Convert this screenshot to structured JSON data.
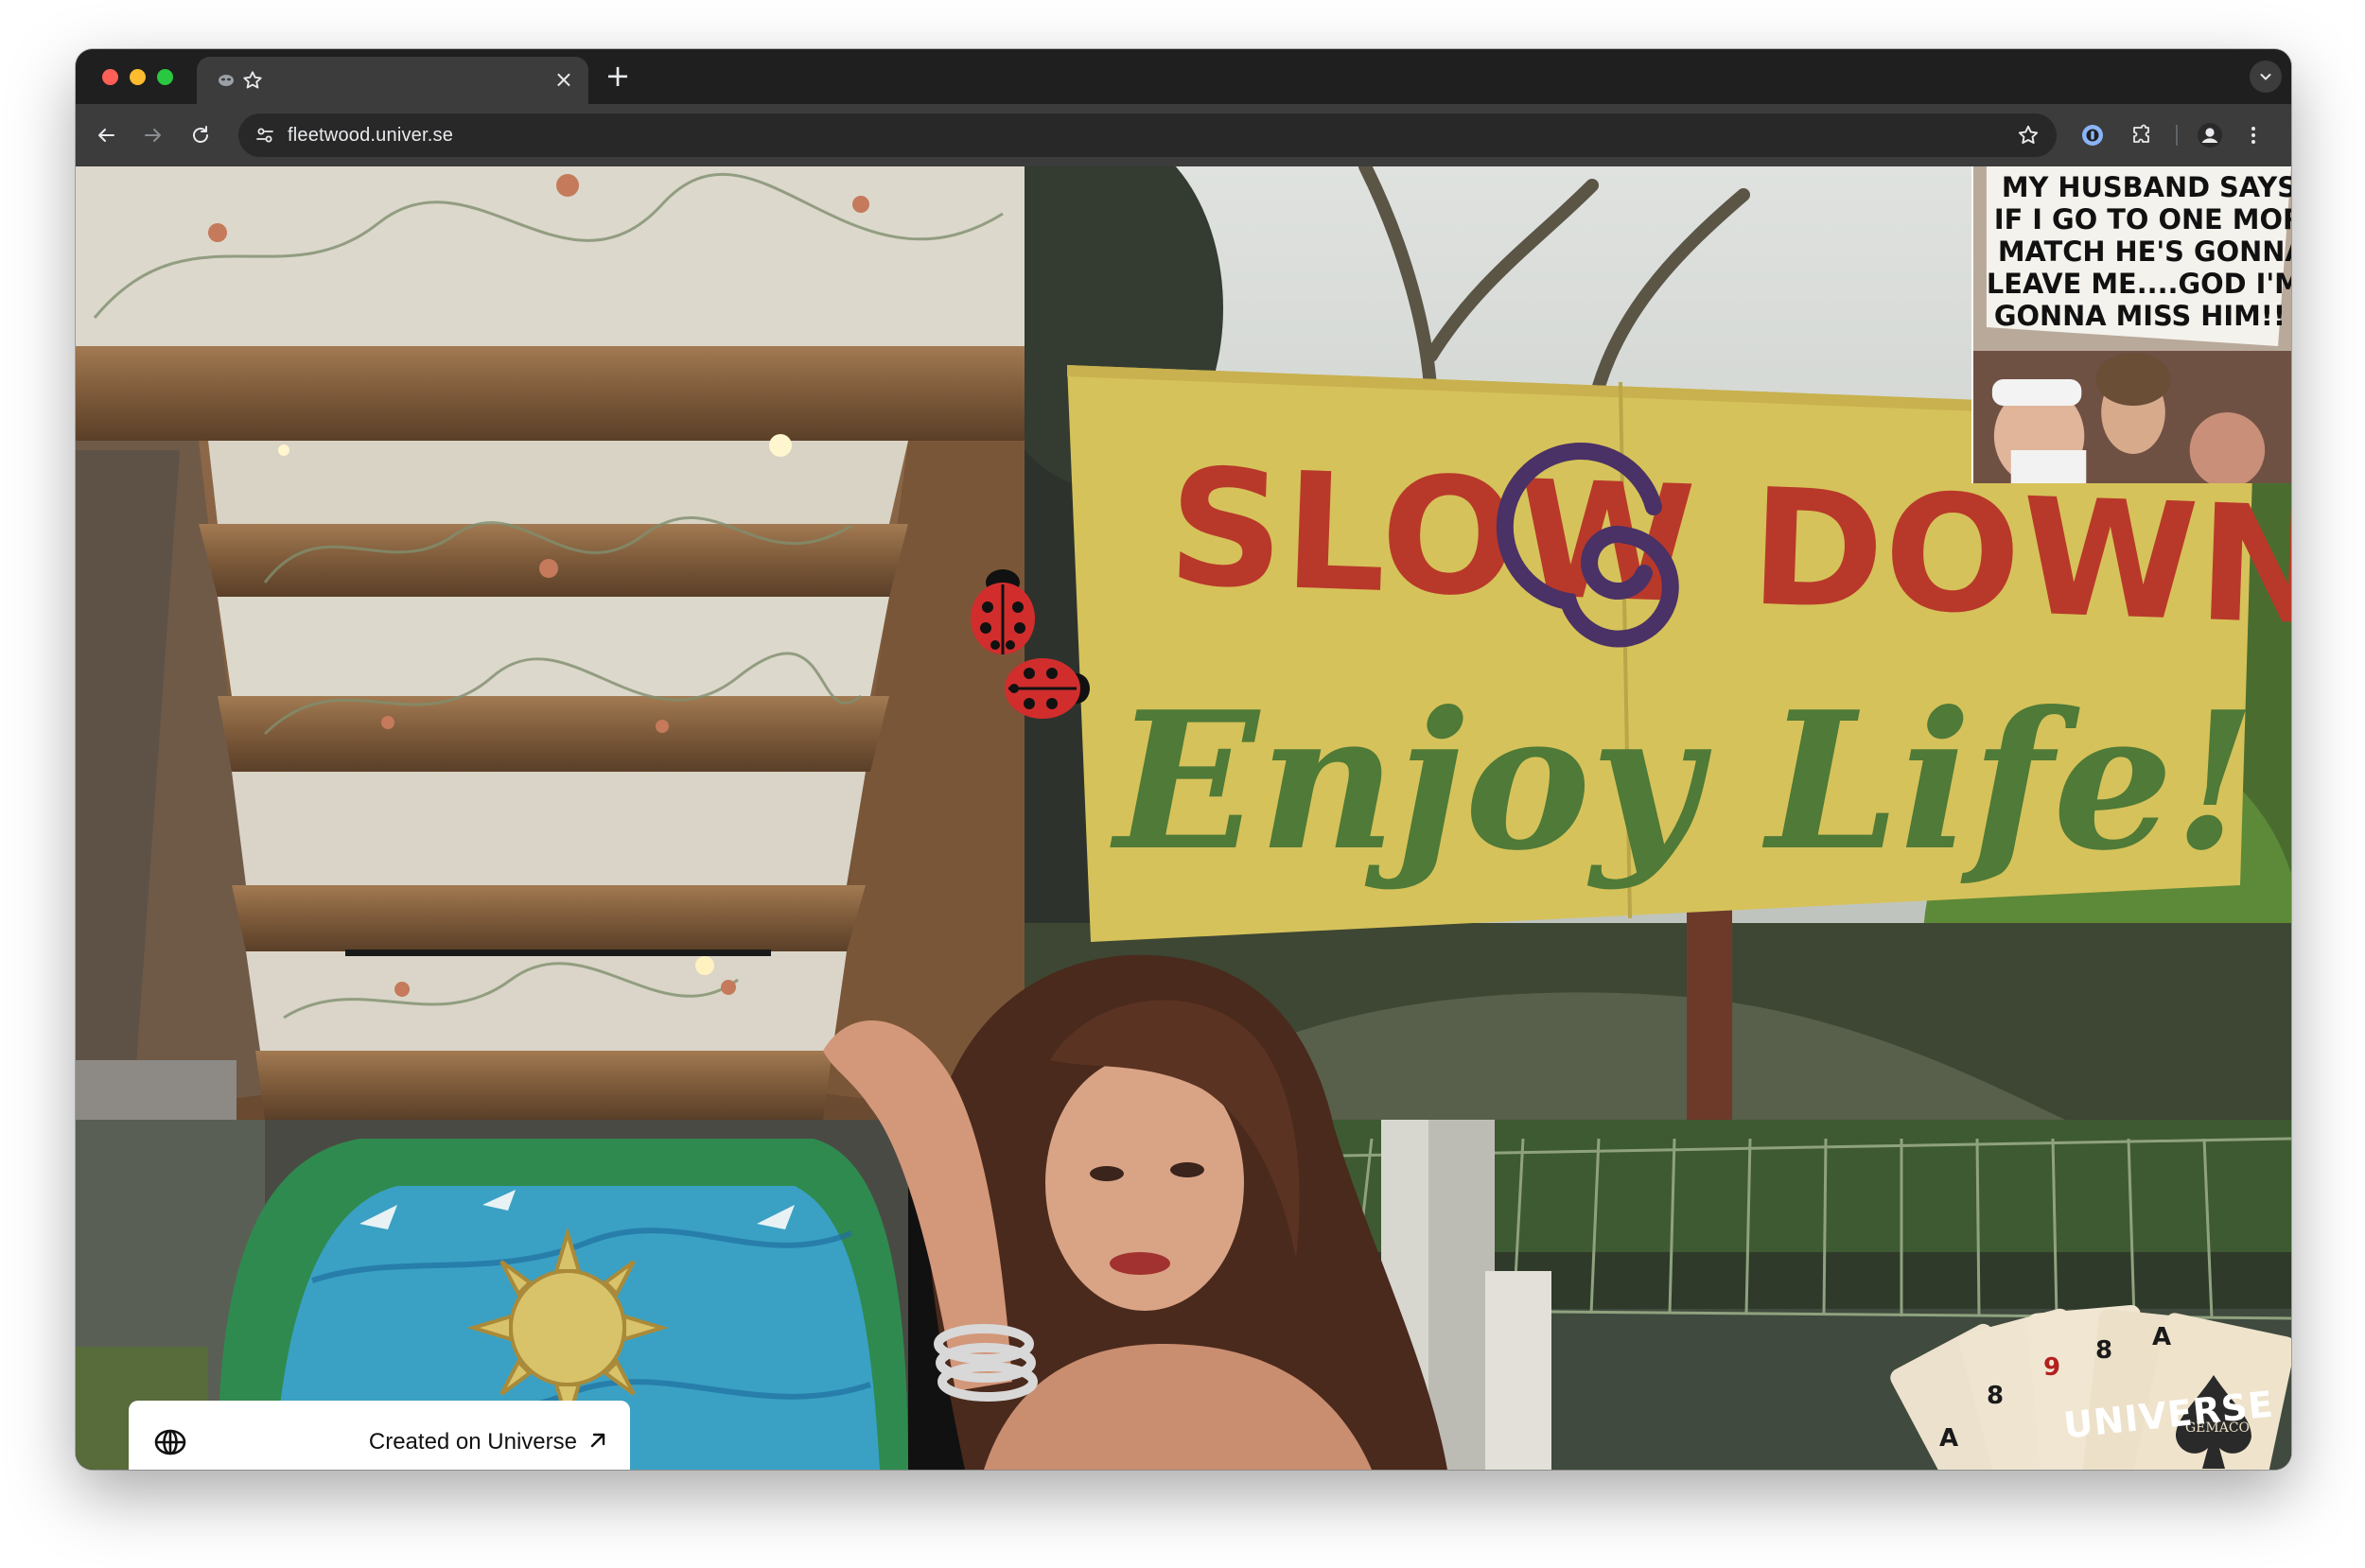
{
  "browser": {
    "tab": {
      "favicon": "mask-icon",
      "pinned_icon": "star-icon",
      "close_glyph": "×"
    },
    "new_tab_glyph": "+",
    "url": "fleetwood.univer.se",
    "icons": {
      "back": "arrow-left-icon",
      "forward": "arrow-right-icon",
      "reload": "reload-icon",
      "site_info": "tune-icon",
      "bookmark": "star-outline-icon",
      "password_manager": "password-icon",
      "extensions": "puzzle-icon",
      "profile": "profile-icon",
      "menu": "kebab-menu-icon",
      "tab_search": "chevron-down-icon"
    }
  },
  "page": {
    "sign": {
      "line1": "SLOW DOWN...",
      "line2": "Enjoy Life!"
    },
    "meme": {
      "lines": [
        "MY HUSBAND SAYS",
        "IF I GO TO ONE MORE",
        "MATCH HE'S GONNA",
        "LEAVE ME....GOD I'M",
        "GONNA MISS HIM!!"
      ]
    },
    "cards": {
      "ranks": [
        "A",
        "8",
        "9",
        "8",
        "A"
      ],
      "brand": "GEMACO"
    },
    "badge": {
      "label": "Created on Universe",
      "globe_icon": "globe-icon",
      "arrow_icon": "arrow-up-right-icon"
    },
    "logo": "UNIVERSE"
  },
  "colors": {
    "chrome_bg": "#1f1f1f",
    "toolbar_bg": "#3c3c3c",
    "omnibox_bg": "#282828",
    "sign_bg": "#d6c25a",
    "sign_red": "#b8392a",
    "sign_green": "#4f7a37",
    "sign_purple": "#4a3166"
  }
}
